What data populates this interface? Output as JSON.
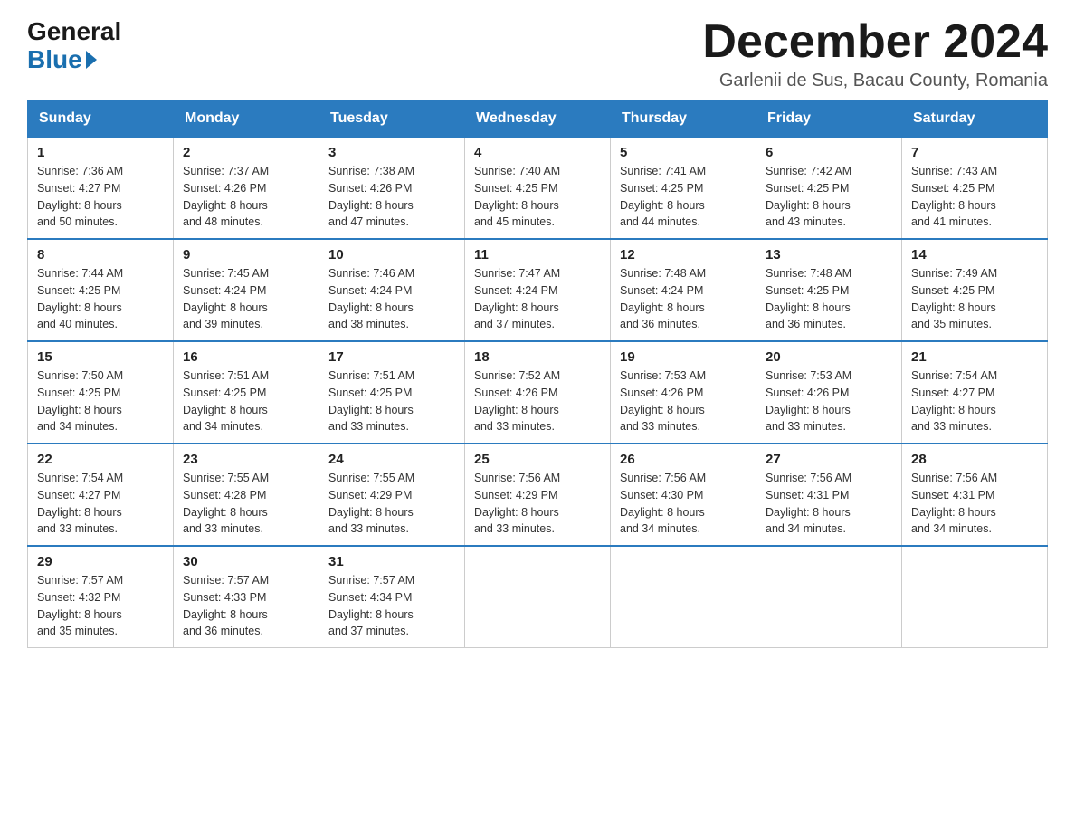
{
  "logo": {
    "general": "General",
    "blue": "Blue"
  },
  "header": {
    "month": "December 2024",
    "location": "Garlenii de Sus, Bacau County, Romania"
  },
  "weekdays": [
    "Sunday",
    "Monday",
    "Tuesday",
    "Wednesday",
    "Thursday",
    "Friday",
    "Saturday"
  ],
  "weeks": [
    [
      {
        "day": "1",
        "sunrise": "7:36 AM",
        "sunset": "4:27 PM",
        "daylight": "8 hours and 50 minutes."
      },
      {
        "day": "2",
        "sunrise": "7:37 AM",
        "sunset": "4:26 PM",
        "daylight": "8 hours and 48 minutes."
      },
      {
        "day": "3",
        "sunrise": "7:38 AM",
        "sunset": "4:26 PM",
        "daylight": "8 hours and 47 minutes."
      },
      {
        "day": "4",
        "sunrise": "7:40 AM",
        "sunset": "4:25 PM",
        "daylight": "8 hours and 45 minutes."
      },
      {
        "day": "5",
        "sunrise": "7:41 AM",
        "sunset": "4:25 PM",
        "daylight": "8 hours and 44 minutes."
      },
      {
        "day": "6",
        "sunrise": "7:42 AM",
        "sunset": "4:25 PM",
        "daylight": "8 hours and 43 minutes."
      },
      {
        "day": "7",
        "sunrise": "7:43 AM",
        "sunset": "4:25 PM",
        "daylight": "8 hours and 41 minutes."
      }
    ],
    [
      {
        "day": "8",
        "sunrise": "7:44 AM",
        "sunset": "4:25 PM",
        "daylight": "8 hours and 40 minutes."
      },
      {
        "day": "9",
        "sunrise": "7:45 AM",
        "sunset": "4:24 PM",
        "daylight": "8 hours and 39 minutes."
      },
      {
        "day": "10",
        "sunrise": "7:46 AM",
        "sunset": "4:24 PM",
        "daylight": "8 hours and 38 minutes."
      },
      {
        "day": "11",
        "sunrise": "7:47 AM",
        "sunset": "4:24 PM",
        "daylight": "8 hours and 37 minutes."
      },
      {
        "day": "12",
        "sunrise": "7:48 AM",
        "sunset": "4:24 PM",
        "daylight": "8 hours and 36 minutes."
      },
      {
        "day": "13",
        "sunrise": "7:48 AM",
        "sunset": "4:25 PM",
        "daylight": "8 hours and 36 minutes."
      },
      {
        "day": "14",
        "sunrise": "7:49 AM",
        "sunset": "4:25 PM",
        "daylight": "8 hours and 35 minutes."
      }
    ],
    [
      {
        "day": "15",
        "sunrise": "7:50 AM",
        "sunset": "4:25 PM",
        "daylight": "8 hours and 34 minutes."
      },
      {
        "day": "16",
        "sunrise": "7:51 AM",
        "sunset": "4:25 PM",
        "daylight": "8 hours and 34 minutes."
      },
      {
        "day": "17",
        "sunrise": "7:51 AM",
        "sunset": "4:25 PM",
        "daylight": "8 hours and 33 minutes."
      },
      {
        "day": "18",
        "sunrise": "7:52 AM",
        "sunset": "4:26 PM",
        "daylight": "8 hours and 33 minutes."
      },
      {
        "day": "19",
        "sunrise": "7:53 AM",
        "sunset": "4:26 PM",
        "daylight": "8 hours and 33 minutes."
      },
      {
        "day": "20",
        "sunrise": "7:53 AM",
        "sunset": "4:26 PM",
        "daylight": "8 hours and 33 minutes."
      },
      {
        "day": "21",
        "sunrise": "7:54 AM",
        "sunset": "4:27 PM",
        "daylight": "8 hours and 33 minutes."
      }
    ],
    [
      {
        "day": "22",
        "sunrise": "7:54 AM",
        "sunset": "4:27 PM",
        "daylight": "8 hours and 33 minutes."
      },
      {
        "day": "23",
        "sunrise": "7:55 AM",
        "sunset": "4:28 PM",
        "daylight": "8 hours and 33 minutes."
      },
      {
        "day": "24",
        "sunrise": "7:55 AM",
        "sunset": "4:29 PM",
        "daylight": "8 hours and 33 minutes."
      },
      {
        "day": "25",
        "sunrise": "7:56 AM",
        "sunset": "4:29 PM",
        "daylight": "8 hours and 33 minutes."
      },
      {
        "day": "26",
        "sunrise": "7:56 AM",
        "sunset": "4:30 PM",
        "daylight": "8 hours and 34 minutes."
      },
      {
        "day": "27",
        "sunrise": "7:56 AM",
        "sunset": "4:31 PM",
        "daylight": "8 hours and 34 minutes."
      },
      {
        "day": "28",
        "sunrise": "7:56 AM",
        "sunset": "4:31 PM",
        "daylight": "8 hours and 34 minutes."
      }
    ],
    [
      {
        "day": "29",
        "sunrise": "7:57 AM",
        "sunset": "4:32 PM",
        "daylight": "8 hours and 35 minutes."
      },
      {
        "day": "30",
        "sunrise": "7:57 AM",
        "sunset": "4:33 PM",
        "daylight": "8 hours and 36 minutes."
      },
      {
        "day": "31",
        "sunrise": "7:57 AM",
        "sunset": "4:34 PM",
        "daylight": "8 hours and 37 minutes."
      },
      null,
      null,
      null,
      null
    ]
  ],
  "labels": {
    "sunrise": "Sunrise:",
    "sunset": "Sunset:",
    "daylight": "Daylight:"
  }
}
